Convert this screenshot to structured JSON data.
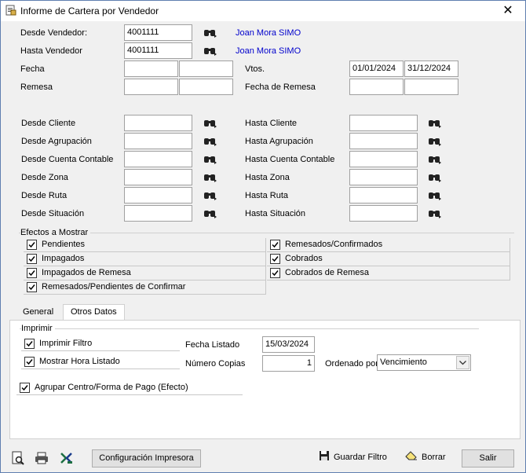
{
  "window": {
    "title": "Informe de Cartera por Vendedor",
    "close_glyph": "✕"
  },
  "top": {
    "desde_vendedor": {
      "label": "Desde Vendedor:",
      "value": "4001111",
      "name": "Joan Mora SIMO"
    },
    "hasta_vendedor": {
      "label": "Hasta Vendedor",
      "value": "4001111",
      "name": "Joan Mora SIMO"
    },
    "fecha": {
      "label": "Fecha",
      "from": "",
      "to": ""
    },
    "vtos": {
      "label": "Vtos.",
      "from": "01/01/2024",
      "to": "31/12/2024"
    },
    "remesa": {
      "label": "Remesa",
      "from": "",
      "to": ""
    },
    "fecha_remesa": {
      "label": "Fecha de Remesa",
      "from": "",
      "to": ""
    }
  },
  "ranges": [
    {
      "from_label": "Desde Cliente",
      "from_value": "",
      "to_label": "Hasta Cliente",
      "to_value": ""
    },
    {
      "from_label": "Desde Agrupación",
      "from_value": "",
      "to_label": "Hasta Agrupación",
      "to_value": ""
    },
    {
      "from_label": "Desde Cuenta Contable",
      "from_value": "",
      "to_label": "Hasta Cuenta Contable",
      "to_value": ""
    },
    {
      "from_label": "Desde Zona",
      "from_value": "",
      "to_label": "Hasta Zona",
      "to_value": ""
    },
    {
      "from_label": "Desde Ruta",
      "from_value": "",
      "to_label": "Hasta Ruta",
      "to_value": ""
    },
    {
      "from_label": "Desde Situación",
      "from_value": "",
      "to_label": "Hasta Situación",
      "to_value": ""
    }
  ],
  "efectos": {
    "title": "Efectos a Mostrar",
    "left": [
      {
        "label": "Pendientes",
        "checked": true
      },
      {
        "label": "Impagados",
        "checked": true
      },
      {
        "label": "Impagados de Remesa",
        "checked": true
      },
      {
        "label": "Remesados/Pendientes de Confirmar",
        "checked": true
      }
    ],
    "right": [
      {
        "label": "Remesados/Confirmados",
        "checked": true
      },
      {
        "label": "Cobrados",
        "checked": true
      },
      {
        "label": "Cobrados de Remesa",
        "checked": true
      }
    ]
  },
  "tabs": [
    {
      "label": "General",
      "active": false
    },
    {
      "label": "Otros Datos",
      "active": true
    }
  ],
  "otros": {
    "imprimir_title": "Imprimir",
    "imprimir_filtro": {
      "label": "Imprimir Filtro",
      "checked": true
    },
    "mostrar_hora": {
      "label": "Mostrar Hora Listado",
      "checked": true
    },
    "fecha_listado": {
      "label": "Fecha Listado",
      "value": "15/03/2024"
    },
    "numero_copias": {
      "label": "Número Copias",
      "value": "1"
    },
    "ordenado_por": {
      "label": "Ordenado por",
      "value": "Vencimiento"
    },
    "agrupar": {
      "label": "Agrupar Centro/Forma de Pago (Efecto)",
      "checked": true
    }
  },
  "footer": {
    "config_label": "Configuración Impresora",
    "guardar_label": "Guardar Filtro",
    "borrar_label": "Borrar",
    "salir_label": "Salir"
  },
  "icons": {
    "app": "report-icon",
    "lookup": "binoculars-icon",
    "preview": "print-preview-icon",
    "print": "printer-icon",
    "excel": "excel-icon",
    "save": "floppy-disk-icon",
    "eraser": "eraser-icon"
  }
}
